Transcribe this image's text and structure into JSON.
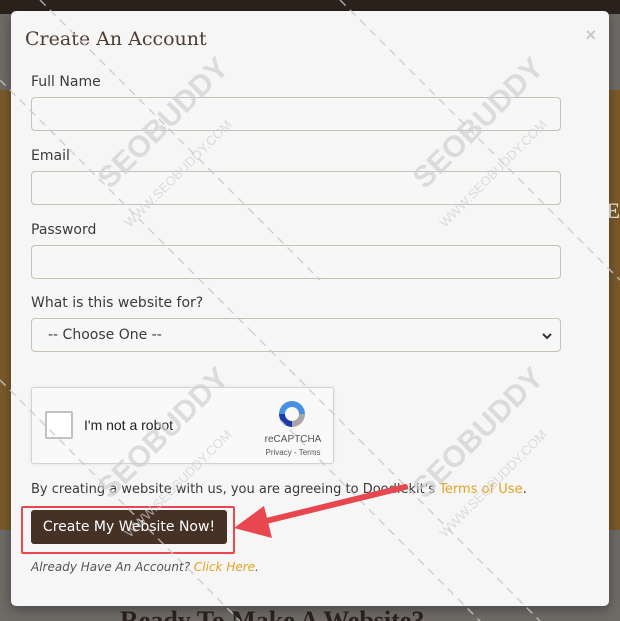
{
  "modal": {
    "title": "Create An Account",
    "close_symbol": "×"
  },
  "form": {
    "full_name_label": "Full Name",
    "full_name_value": "",
    "email_label": "Email",
    "email_value": "",
    "password_label": "Password",
    "password_value": "",
    "purpose_label": "What is this website for?",
    "purpose_selected": "-- Choose One --"
  },
  "recaptcha": {
    "label": "I'm not a robot",
    "brand": "reCAPTCHA",
    "links": "Privacy - Terms"
  },
  "agreement": {
    "text": "By creating a website with us, you are agreeing to Doodlekit's ",
    "link": "Terms of Use",
    "end": "."
  },
  "submit_label": "Create My Website Now!",
  "login": {
    "text": "Already Have An Account? ",
    "link": "Click Here",
    "end": "."
  },
  "watermark": {
    "brand": "SEOBUDDY",
    "url": "WWW.SEOBUDDY.COM"
  },
  "background": {
    "side_text": "TE",
    "bottom_text": "Ready To Make A Website?"
  },
  "colors": {
    "accent_link": "#e3a321",
    "button_bg": "#463127",
    "highlight": "#e8474f"
  }
}
